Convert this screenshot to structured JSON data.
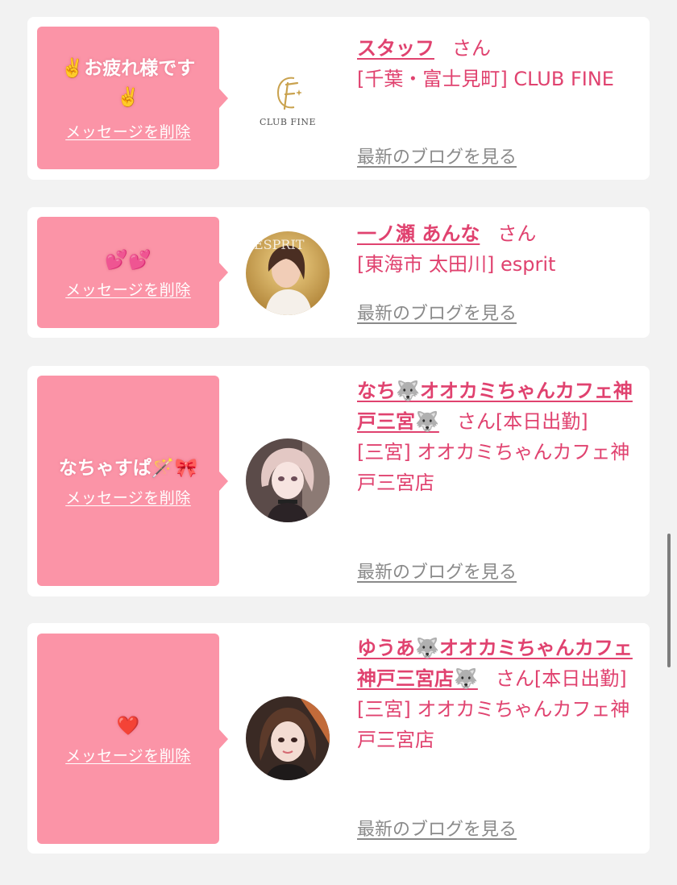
{
  "colors": {
    "background": "#f2f2f2",
    "card": "#ffffff",
    "bubble": "#fb94a7",
    "accent_text": "#e0426f",
    "link_gray": "#8a8a8a"
  },
  "messages": [
    {
      "bubble_text": "✌️お疲れ様です✌️",
      "delete_label": "メッセージを削除",
      "avatar_icon": "club-fine-logo",
      "logo_text": "CLUB FINE",
      "name": "スタッフ",
      "suffix": "さん",
      "shop": "[千葉・富士見町] CLUB FINE",
      "blog_label": "最新のブログを見る"
    },
    {
      "bubble_text": "💕💕",
      "delete_label": "メッセージを削除",
      "avatar_icon": "profile-photo",
      "name": "一ノ瀬 あんな",
      "suffix": "さん",
      "shop": "[東海市 太田川] esprit",
      "blog_label": "最新のブログを見る"
    },
    {
      "bubble_text": "なちゃすぱ🪄🎀",
      "delete_label": "メッセージを削除",
      "avatar_icon": "profile-photo",
      "name": "なち🐺オオカミちゃんカフェ神戸三宮🐺",
      "suffix": "さん[本日出勤]",
      "shop": "[三宮] オオカミちゃんカフェ神戸三宮店",
      "blog_label": "最新のブログを見る"
    },
    {
      "bubble_text": "❤️",
      "delete_label": "メッセージを削除",
      "avatar_icon": "profile-photo",
      "name": "ゆうあ🐺オオカミちゃんカフェ神戸三宮店🐺",
      "suffix": "さん[本日出勤]",
      "shop": "[三宮] オオカミちゃんカフェ神戸三宮店",
      "blog_label": "最新のブログを見る"
    }
  ]
}
